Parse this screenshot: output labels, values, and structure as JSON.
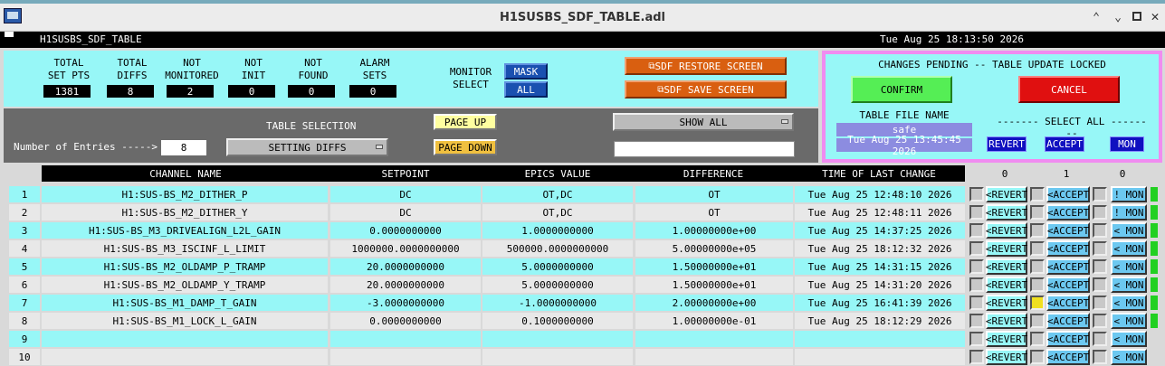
{
  "window": {
    "title": "H1SUSBS_SDF_TABLE.adl"
  },
  "header": {
    "name": "H1SUSBS_SDF_TABLE",
    "datetime": "Tue Aug 25 18:13:50 2026"
  },
  "stats": [
    {
      "label1": "TOTAL",
      "label2": "SET PTS",
      "value": "1381"
    },
    {
      "label1": "TOTAL",
      "label2": "DIFFS",
      "value": "8"
    },
    {
      "label1": "NOT",
      "label2": "MONITORED",
      "value": "2"
    },
    {
      "label1": "NOT",
      "label2": "INIT",
      "value": "0"
    },
    {
      "label1": "NOT",
      "label2": "FOUND",
      "value": "0"
    },
    {
      "label1": "ALARM",
      "label2": "SETS",
      "value": "0"
    }
  ],
  "monitor": {
    "label1": "MONITOR",
    "label2": "SELECT",
    "mask": "MASK",
    "all": "ALL"
  },
  "actions": {
    "restore": "SDF RESTORE SCREEN",
    "save": "SDF SAVE SCREEN"
  },
  "pending": {
    "title": "CHANGES PENDING -- TABLE UPDATE LOCKED",
    "confirm": "CONFIRM",
    "cancel": "CANCEL",
    "file_label": "TABLE FILE NAME",
    "file_name": "safe",
    "file_time": "Tue Aug 25 13:45:45 2026",
    "select_all": "------- SELECT ALL --------",
    "revert": "REVERT",
    "accept": "ACCEPT",
    "mon": "MON"
  },
  "selection": {
    "label": "TABLE SELECTION",
    "entries_label": "Number of Entries ----->",
    "entries_value": "8",
    "dropdown": "SETTING DIFFS",
    "page_up": "PAGE UP",
    "page_down": "PAGE DOWN",
    "show_all": "SHOW ALL",
    "filter_value": ""
  },
  "table": {
    "headers": [
      "CHANNEL NAME",
      "SETPOINT",
      "EPICS VALUE",
      "DIFFERENCE",
      "TIME OF LAST CHANGE"
    ],
    "col_counts": [
      "0",
      "1",
      "0"
    ],
    "rows": [
      {
        "n": "1",
        "channel": "H1:SUS-BS_M2_DITHER_P",
        "setpoint": "DC",
        "epics": "OT,DC",
        "diff": "OT",
        "time": "Tue Aug 25 12:48:10 2026",
        "revert": "<REVERT",
        "accept": "<ACCEPT",
        "mon": "! MON",
        "mon_excl": true,
        "accept_yellow": false
      },
      {
        "n": "2",
        "channel": "H1:SUS-BS_M2_DITHER_Y",
        "setpoint": "DC",
        "epics": "OT,DC",
        "diff": "OT",
        "time": "Tue Aug 25 12:48:11 2026",
        "revert": "<REVERT",
        "accept": "<ACCEPT",
        "mon": "! MON",
        "mon_excl": true,
        "accept_yellow": false
      },
      {
        "n": "3",
        "channel": "H1:SUS-BS_M3_DRIVEALIGN_L2L_GAIN",
        "setpoint": "0.0000000000",
        "epics": "1.0000000000",
        "diff": "1.00000000e+00",
        "time": "Tue Aug 25 14:37:25 2026",
        "revert": "<REVERT",
        "accept": "<ACCEPT",
        "mon": "< MON",
        "mon_excl": false,
        "accept_yellow": false
      },
      {
        "n": "4",
        "channel": "H1:SUS-BS_M3_ISCINF_L_LIMIT",
        "setpoint": "1000000.0000000000",
        "epics": "500000.0000000000",
        "diff": "5.00000000e+05",
        "time": "Tue Aug 25 18:12:32 2026",
        "revert": "<REVERT",
        "accept": "<ACCEPT",
        "mon": "< MON",
        "mon_excl": false,
        "accept_yellow": false
      },
      {
        "n": "5",
        "channel": "H1:SUS-BS_M2_OLDAMP_P_TRAMP",
        "setpoint": "20.0000000000",
        "epics": "5.0000000000",
        "diff": "1.50000000e+01",
        "time": "Tue Aug 25 14:31:15 2026",
        "revert": "<REVERT",
        "accept": "<ACCEPT",
        "mon": "< MON",
        "mon_excl": false,
        "accept_yellow": false
      },
      {
        "n": "6",
        "channel": "H1:SUS-BS_M2_OLDAMP_Y_TRAMP",
        "setpoint": "20.0000000000",
        "epics": "5.0000000000",
        "diff": "1.50000000e+01",
        "time": "Tue Aug 25 14:31:20 2026",
        "revert": "<REVERT",
        "accept": "<ACCEPT",
        "mon": "< MON",
        "mon_excl": false,
        "accept_yellow": false
      },
      {
        "n": "7",
        "channel": "H1:SUS-BS_M1_DAMP_T_GAIN",
        "setpoint": "-3.0000000000",
        "epics": "-1.0000000000",
        "diff": "2.00000000e+00",
        "time": "Tue Aug 25 16:41:39 2026",
        "revert": "<REVERT",
        "accept": "<ACCEPT",
        "mon": "< MON",
        "mon_excl": false,
        "accept_yellow": true
      },
      {
        "n": "8",
        "channel": "H1:SUS-BS_M1_LOCK_L_GAIN",
        "setpoint": "0.0000000000",
        "epics": "0.1000000000",
        "diff": "1.00000000e-01",
        "time": "Tue Aug 25 18:12:29 2026",
        "revert": "<REVERT",
        "accept": "<ACCEPT",
        "mon": "< MON",
        "mon_excl": false,
        "accept_yellow": false
      },
      {
        "n": "9",
        "channel": "",
        "setpoint": "",
        "epics": "",
        "diff": "",
        "time": "",
        "revert": "<REVERT",
        "accept": "<ACCEPT",
        "mon": "< MON",
        "mon_excl": false,
        "accept_yellow": false
      },
      {
        "n": "10",
        "channel": "",
        "setpoint": "",
        "epics": "",
        "diff": "",
        "time": "",
        "revert": "<REVERT",
        "accept": "<ACCEPT",
        "mon": "< MON",
        "mon_excl": false,
        "accept_yellow": false
      }
    ]
  },
  "colors": {
    "cyan": "#97f7f7",
    "orange": "#d95f10",
    "magenta_border": "#f08cf0",
    "green": "#55ee55",
    "red": "#e01010"
  }
}
